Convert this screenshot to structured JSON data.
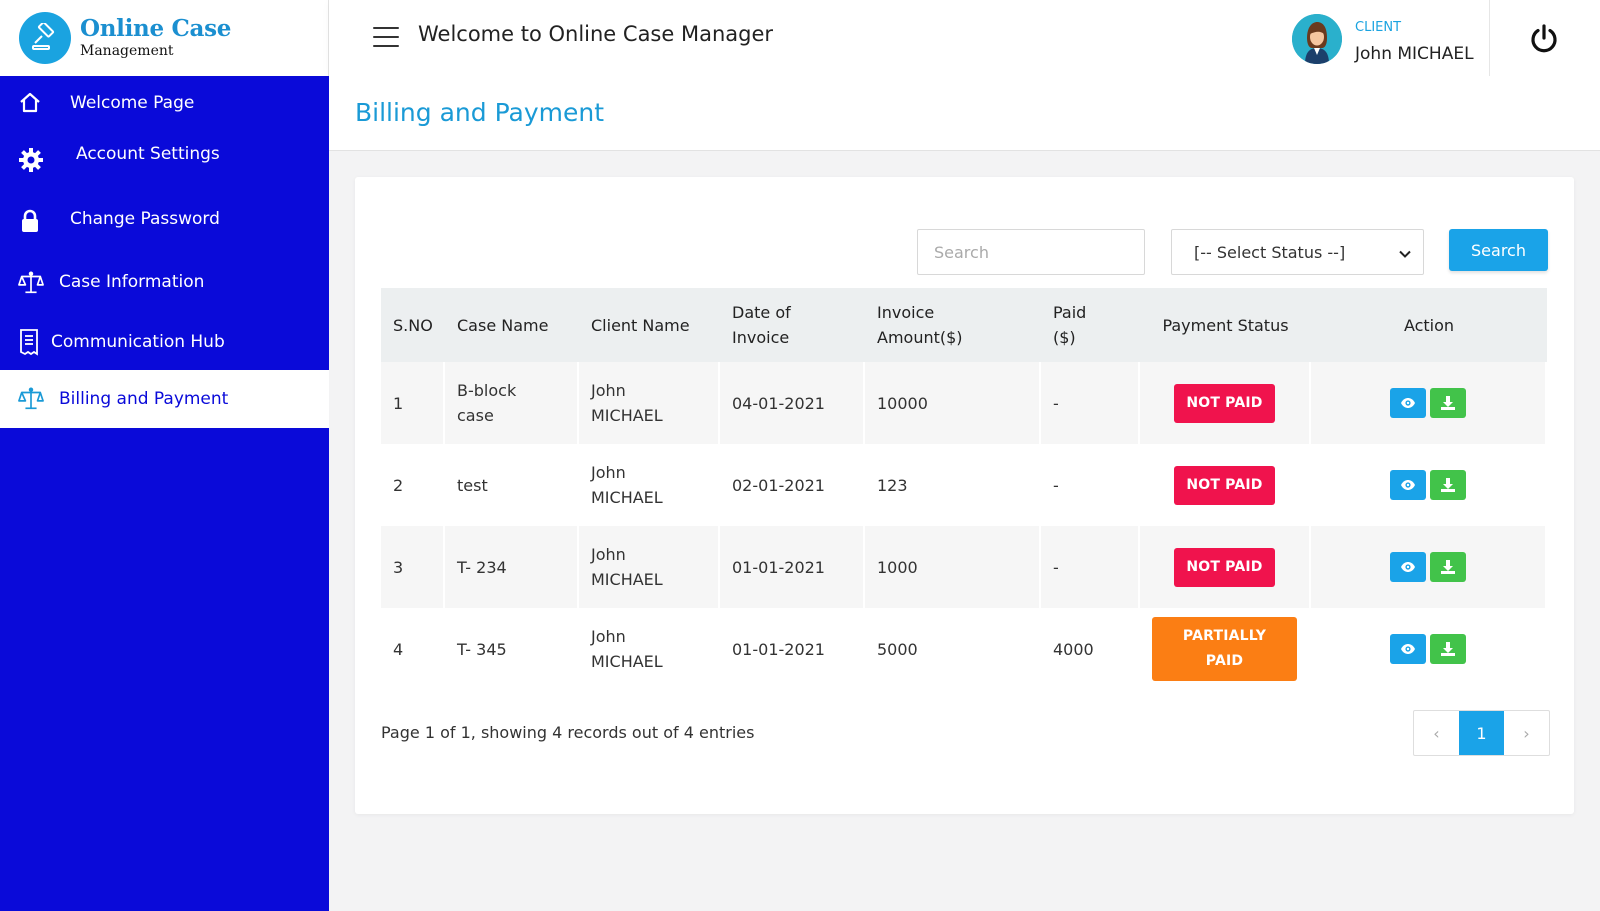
{
  "brand": {
    "title": "Online Case",
    "subtitle": "Management"
  },
  "header": {
    "welcome": "Welcome to Online Case Manager",
    "user_role": "CLIENT",
    "user_name": "John MICHAEL"
  },
  "sidebar": {
    "items": [
      {
        "label": "Welcome Page",
        "icon": "home-icon"
      },
      {
        "label": "Account Settings",
        "icon": "gear-icon"
      },
      {
        "label": "Change Password",
        "icon": "lock-icon"
      },
      {
        "label": "Case Information",
        "icon": "scales-icon"
      },
      {
        "label": "Communication Hub",
        "icon": "receipt-icon"
      },
      {
        "label": "Billing and Payment",
        "icon": "scales-icon",
        "active": true
      }
    ]
  },
  "page": {
    "title": "Billing and Payment"
  },
  "filters": {
    "search_placeholder": "Search",
    "status_selected": "[-- Select Status --]",
    "search_button": "Search"
  },
  "table": {
    "columns": [
      "S.NO",
      "Case Name",
      "Client Name",
      "Date of Invoice",
      "Invoice Amount($)",
      "Paid ($)",
      "Payment Status",
      "Action"
    ],
    "rows": [
      {
        "sno": "1",
        "case": "B-block case",
        "client": "John MICHAEL",
        "date": "04-01-2021",
        "amount": "10000",
        "paid": "-",
        "status": "NOT PAID"
      },
      {
        "sno": "2",
        "case": "test",
        "client": "John MICHAEL",
        "date": "02-01-2021",
        "amount": "123",
        "paid": "-",
        "status": "NOT PAID"
      },
      {
        "sno": "3",
        "case": "T- 234",
        "client": "John MICHAEL",
        "date": "01-01-2021",
        "amount": "1000",
        "paid": "-",
        "status": "NOT PAID"
      },
      {
        "sno": "4",
        "case": "T- 345",
        "client": "John MICHAEL",
        "date": "01-01-2021",
        "amount": "5000",
        "paid": "4000",
        "status": "PARTIALLY PAID"
      }
    ]
  },
  "pagination": {
    "info": "Page 1 of 1, showing 4 records out of 4 entries",
    "prev": "‹",
    "current": "1",
    "next": "›"
  },
  "colors": {
    "sidebar": "#0a0ad9",
    "accent": "#1aa3e8",
    "not_paid": "#f0134d",
    "partially_paid": "#fb7e14",
    "download": "#42c34a"
  }
}
